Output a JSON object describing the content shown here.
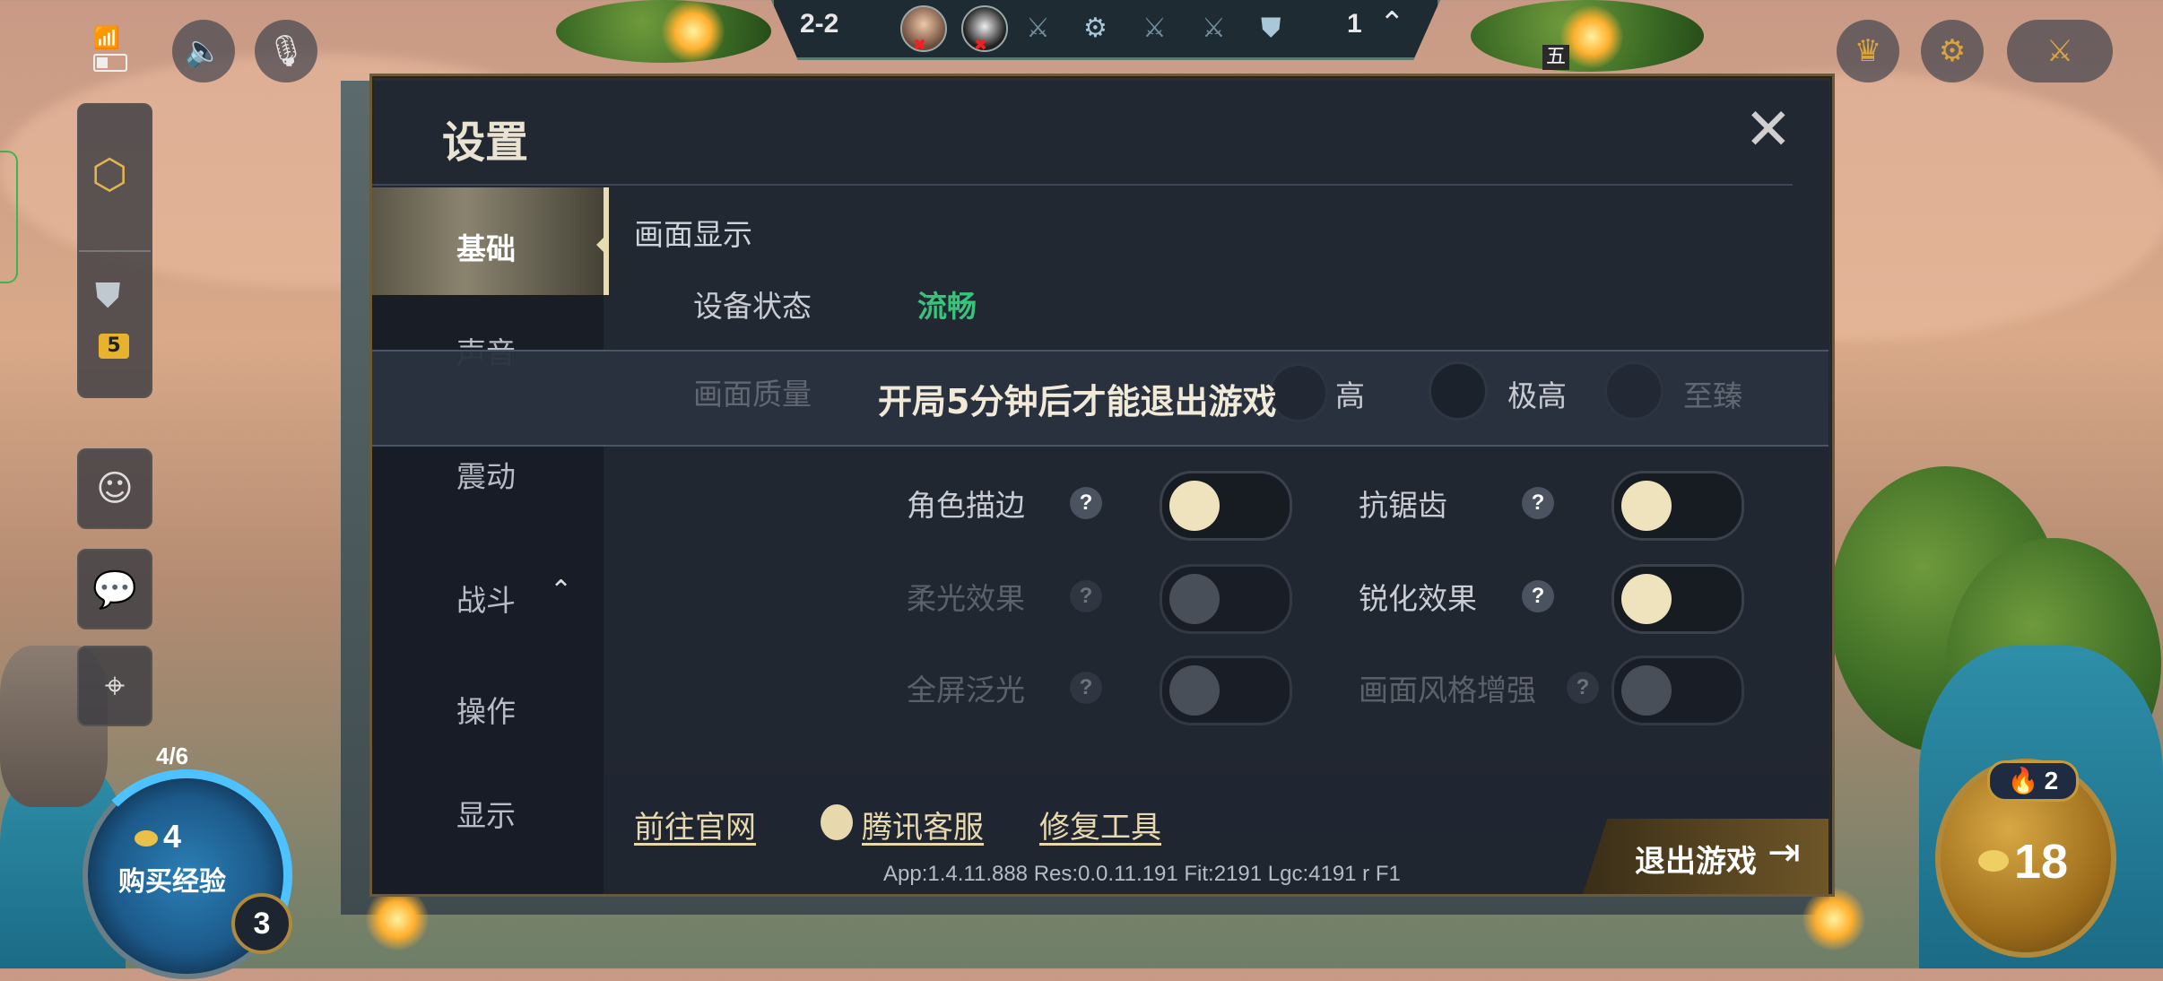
{
  "hud": {
    "round": "2-2",
    "level": "1",
    "stage_icons": [
      "swords-icon",
      "gear-stage-icon",
      "swords-icon",
      "swords-icon",
      "armor-stage-icon"
    ],
    "marker": "五"
  },
  "dialog": {
    "title": "设置",
    "close": "✕",
    "nav": [
      "基础",
      "声音",
      "震动",
      "战斗",
      "操作",
      "显示"
    ],
    "active_nav": "基础",
    "section_title": "画面显示",
    "device_state_label": "设备状态",
    "device_state_value": "流畅",
    "quality_label": "画面质量",
    "quality_options": [
      "高",
      "极高",
      "至臻"
    ],
    "toast": "开局5分钟后才能退出游戏",
    "toggles": [
      {
        "label": "角色描边",
        "help": "?",
        "on": false,
        "enabled": true
      },
      {
        "label": "抗锯齿",
        "help": "?",
        "on": false,
        "enabled": true
      },
      {
        "label": "柔光效果",
        "help": "?",
        "on": false,
        "enabled": false
      },
      {
        "label": "锐化效果",
        "help": "?",
        "on": false,
        "enabled": true
      },
      {
        "label": "全屏泛光",
        "help": "?",
        "on": false,
        "enabled": false
      },
      {
        "label": "画面风格增强",
        "help": "?",
        "on": false,
        "enabled": false
      }
    ],
    "links": {
      "official": "前往官网",
      "support": "腾讯客服",
      "repair": "修复工具"
    },
    "version": "App:1.4.11.888 Res:0.0.11.191 Fit:2191 Lgc:4191 r F1",
    "quit": "退出游戏"
  },
  "left": {
    "badge": "5"
  },
  "bottom": {
    "xp_progress": "4/6",
    "xp_cost": "4",
    "xp_label": "购买经验",
    "player_level": "3",
    "streak": "2",
    "gold": "18"
  },
  "colors": {
    "accent_gold": "#e7d8ae",
    "green": "#38c27a",
    "toggle_knob": "#efe3bd"
  }
}
